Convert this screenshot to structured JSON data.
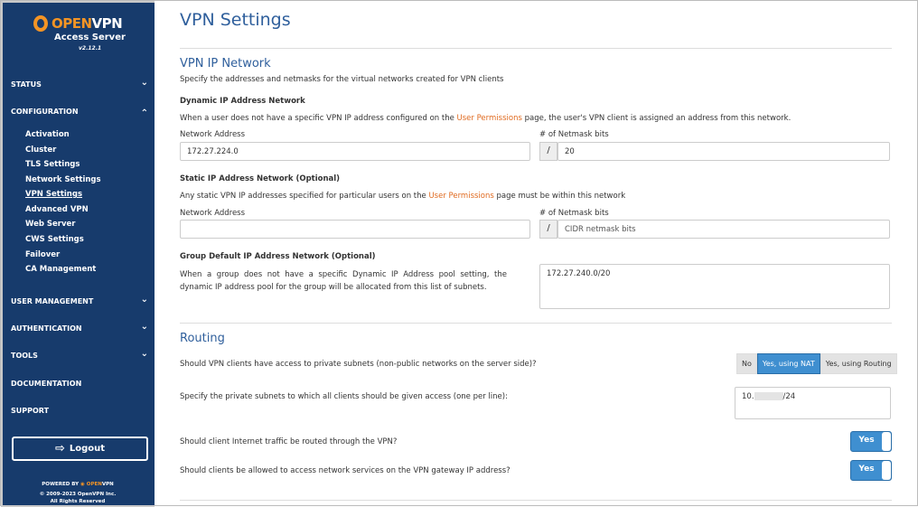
{
  "brand": {
    "name_a": "OPEN",
    "name_b": "VPN",
    "product": "Access Server",
    "version": "v2.12.1"
  },
  "sidebar": {
    "sections": [
      {
        "label": "STATUS",
        "chevron": "down"
      },
      {
        "label": "CONFIGURATION",
        "chevron": "up"
      },
      {
        "label": "USER MANAGEMENT",
        "chevron": "down"
      },
      {
        "label": "AUTHENTICATION",
        "chevron": "down"
      },
      {
        "label": "TOOLS",
        "chevron": "down"
      },
      {
        "label": "DOCUMENTATION"
      },
      {
        "label": "SUPPORT"
      }
    ],
    "config_items": [
      "Activation",
      "Cluster",
      "TLS Settings",
      "Network Settings",
      "VPN Settings",
      "Advanced VPN",
      "Web Server",
      "CWS Settings",
      "Failover",
      "CA Management"
    ],
    "active_item": "VPN Settings",
    "logout": "Logout",
    "footer": {
      "powered_by": "POWERED BY",
      "brand_a": "OPEN",
      "brand_b": "VPN",
      "copyright": "© 2009-2023 OpenVPN Inc.",
      "rights": "All Rights Reserved"
    }
  },
  "page": {
    "title": "VPN Settings",
    "vpn_ip": {
      "heading": "VPN IP Network",
      "desc": "Specify the addresses and netmasks for the virtual networks created for VPN clients",
      "dynamic": {
        "title": "Dynamic IP Address Network",
        "desc_a": "When a user does not have a specific VPN IP address configured on the ",
        "link": "User Permissions",
        "desc_b": " page, the user's VPN client is assigned an address from this network.",
        "addr_label": "Network Address",
        "addr_value": "172.27.224.0",
        "bits_label": "# of Netmask bits",
        "bits_value": "20"
      },
      "static": {
        "title": "Static IP Address Network (Optional)",
        "desc_a": "Any static VPN IP addresses specified for particular users on the ",
        "link": "User Permissions",
        "desc_b": " page must be within this network",
        "addr_label": "Network Address",
        "addr_value": "",
        "bits_label": "# of Netmask bits",
        "bits_placeholder": "CIDR netmask bits"
      },
      "group": {
        "title": "Group Default IP Address Network (Optional)",
        "desc": "When a group does not have a specific Dynamic IP Address pool setting, the dynamic IP address pool for the group will be allocated from this list of subnets.",
        "value": "172.27.240.0/20"
      }
    },
    "routing": {
      "heading": "Routing",
      "q1": "Should VPN clients have access to private subnets (non-public networks on the server side)?",
      "q1_options": [
        "No",
        "Yes, using NAT",
        "Yes, using Routing"
      ],
      "q1_selected": "Yes, using NAT",
      "q2": "Specify the private subnets to which all clients should be given access (one per line):",
      "q2_value_a": "10.",
      "q2_value_b": "/24",
      "q3": "Should client Internet traffic be routed through the VPN?",
      "q3_value": "Yes",
      "q4": "Should clients be allowed to access network services on the VPN gateway IP address?",
      "q4_value": "Yes"
    }
  }
}
